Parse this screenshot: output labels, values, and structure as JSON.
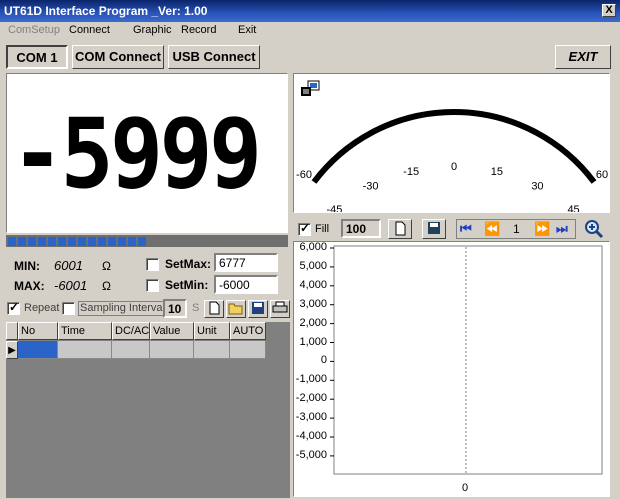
{
  "window": {
    "title": "UT61D Interface Program _Ver: 1.00",
    "close_label": "X"
  },
  "menu": {
    "items": [
      "ComSetup",
      "Connect",
      "Graphic",
      "Record",
      "Exit"
    ]
  },
  "toolbar": {
    "com_port": "COM 1",
    "com_connect": "COM Connect",
    "usb_connect": "USB Connect",
    "exit": "EXIT"
  },
  "display": {
    "value": "-5999"
  },
  "bargraph": {
    "filled_segments": 14
  },
  "stats": {
    "min_label": "MIN:",
    "min_value": "6001",
    "min_unit": "Ω",
    "max_label": "MAX:",
    "max_value": "-6001",
    "max_unit": "Ω",
    "setmax_label": "SetMax:",
    "setmax_value": "6777",
    "setmin_label": "SetMin:",
    "setmin_value": "-6000"
  },
  "record_bar": {
    "repeat_label": "Repeat",
    "sampling_label": "Sampling Interval",
    "sampling_value": "10",
    "sampling_unit": "S"
  },
  "table": {
    "columns": [
      "No",
      "Time",
      "DC/AC",
      "Value",
      "Unit",
      "AUTO"
    ]
  },
  "gauge": {
    "ticks": [
      "-60",
      "-45",
      "-30",
      "-15",
      "0",
      "15",
      "30",
      "45",
      "60"
    ]
  },
  "graph_toolbar": {
    "fill_label": "Fill",
    "points_value": "100",
    "page_value": "1"
  },
  "graph": {
    "y_ticks": [
      "6,000",
      "5,000",
      "4,000",
      "3,000",
      "2,000",
      "1,000",
      "0",
      "-1,000",
      "-2,000",
      "-3,000",
      "-4,000",
      "-5,000"
    ],
    "x_label": "0"
  },
  "colors": {
    "titlebar": "#0a246a",
    "bargraph_fill": "#2a64c8",
    "window_bg": "#d4d0c8"
  }
}
